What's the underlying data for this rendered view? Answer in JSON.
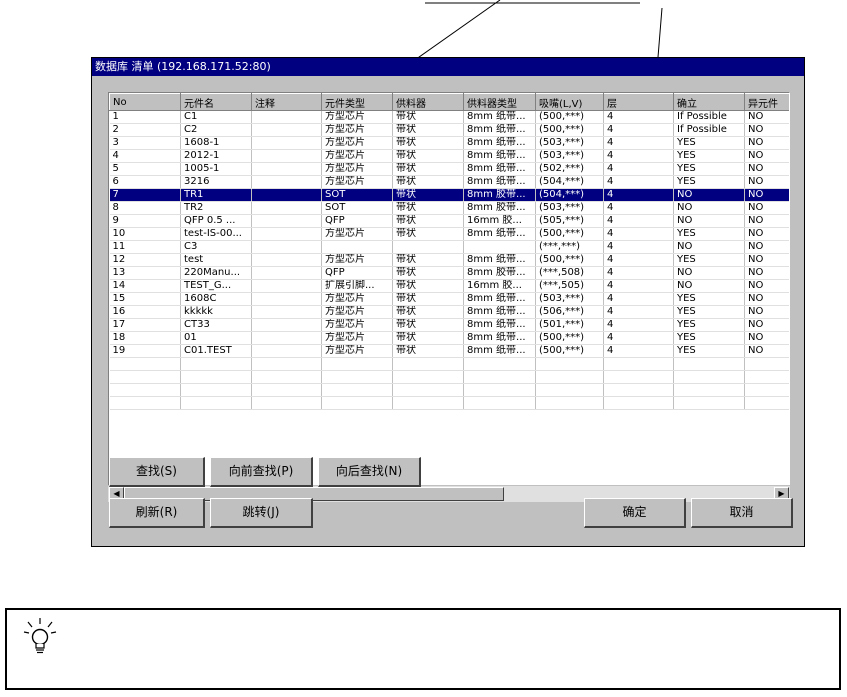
{
  "window": {
    "title": "数据库 清单 (192.168.171.52:80)"
  },
  "table": {
    "columns": [
      "No",
      "元件名",
      "注释",
      "元件类型",
      "供料器",
      "供料器类型",
      "吸嘴(L,V)",
      "层",
      "确立",
      "异元件"
    ],
    "rows": [
      [
        "1",
        "C1",
        "",
        "方型芯片",
        "带状",
        "8mm 纸带...",
        "(500,***)",
        "4",
        "If Possible",
        "NO"
      ],
      [
        "2",
        "C2",
        "",
        "方型芯片",
        "带状",
        "8mm 纸带...",
        "(500,***)",
        "4",
        "If Possible",
        "NO"
      ],
      [
        "3",
        "1608-1",
        "",
        "方型芯片",
        "带状",
        "8mm 纸带...",
        "(503,***)",
        "4",
        "YES",
        "NO"
      ],
      [
        "4",
        "2012-1",
        "",
        "方型芯片",
        "带状",
        "8mm 纸带...",
        "(503,***)",
        "4",
        "YES",
        "NO"
      ],
      [
        "5",
        "1005-1",
        "",
        "方型芯片",
        "带状",
        "8mm 纸带...",
        "(502,***)",
        "4",
        "YES",
        "NO"
      ],
      [
        "6",
        "3216",
        "",
        "方型芯片",
        "带状",
        "8mm 纸带...",
        "(504,***)",
        "4",
        "YES",
        "NO"
      ],
      [
        "7",
        "TR1",
        "",
        "SOT",
        "带状",
        "8mm 胶带...",
        "(504,***)",
        "4",
        "NO",
        "NO"
      ],
      [
        "8",
        "TR2",
        "",
        "SOT",
        "带状",
        "8mm 胶带...",
        "(503,***)",
        "4",
        "NO",
        "NO"
      ],
      [
        "9",
        "QFP 0.5 ...",
        "",
        "QFP",
        "带状",
        "16mm 胶...",
        "(505,***)",
        "4",
        "NO",
        "NO"
      ],
      [
        "10",
        "test-IS-00...",
        "",
        "方型芯片",
        "带状",
        "8mm 纸带...",
        "(500,***)",
        "4",
        "YES",
        "NO"
      ],
      [
        "11",
        "C3",
        "",
        "",
        "",
        "",
        "(***,***)",
        "4",
        "NO",
        "NO"
      ],
      [
        "12",
        "test",
        "",
        "方型芯片",
        "带状",
        "8mm 纸带...",
        "(500,***)",
        "4",
        "YES",
        "NO"
      ],
      [
        "13",
        "220Manu...",
        "",
        "QFP",
        "带状",
        "8mm 胶带...",
        "(***,508)",
        "4",
        "NO",
        "NO"
      ],
      [
        "14",
        "TEST_G...",
        "",
        "扩展引脚...",
        "带状",
        "16mm 胶...",
        "(***,505)",
        "4",
        "NO",
        "NO"
      ],
      [
        "15",
        "1608C",
        "",
        "方型芯片",
        "带状",
        "8mm 纸带...",
        "(503,***)",
        "4",
        "YES",
        "NO"
      ],
      [
        "16",
        "kkkkk",
        "",
        "方型芯片",
        "带状",
        "8mm 纸带...",
        "(506,***)",
        "4",
        "YES",
        "NO"
      ],
      [
        "17",
        "CT33",
        "",
        "方型芯片",
        "带状",
        "8mm 纸带...",
        "(501,***)",
        "4",
        "YES",
        "NO"
      ],
      [
        "18",
        "01",
        "",
        "方型芯片",
        "带状",
        "8mm 纸带...",
        "(500,***)",
        "4",
        "YES",
        "NO"
      ],
      [
        "19",
        "C01.TEST",
        "",
        "方型芯片",
        "带状",
        "8mm 纸带...",
        "(500,***)",
        "4",
        "YES",
        "NO"
      ]
    ],
    "selected_row": 7,
    "focus_row": 4,
    "scroll_left_glyph": "◀",
    "scroll_right_glyph": "▶"
  },
  "buttons": {
    "find": "查找(S)",
    "find_prev": "向前查找(P)",
    "find_next": "向后查找(N)",
    "refresh": "刷新(R)",
    "jump": "跳转(J)",
    "ok": "确定",
    "cancel": "取消"
  },
  "callout": {
    "icon": "lightbulb-icon"
  },
  "colors": {
    "title_bar": "#000080",
    "selection": "#000080",
    "face": "#c0c0c0"
  }
}
